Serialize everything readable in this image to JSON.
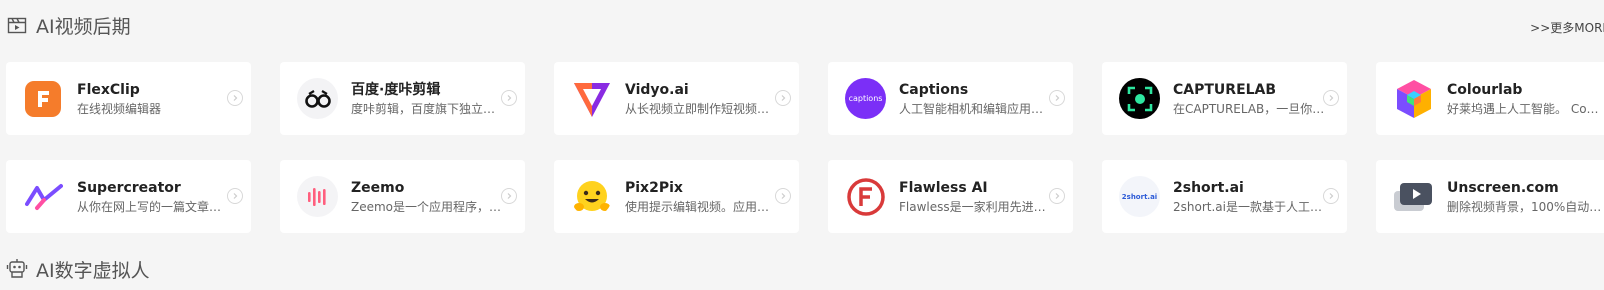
{
  "section1": {
    "title": "AI视频后期",
    "icon": "video-clapper-icon",
    "more_label": ">>更多MORE"
  },
  "section2": {
    "title": "AI数字虚拟人",
    "icon": "robot-icon"
  },
  "tools": [
    {
      "name": "FlexClip",
      "desc": "在线视频编辑器",
      "logo": "flexclip-logo"
    },
    {
      "name": "百度·度咔剪辑",
      "desc": "度咔剪辑，百度旗下独立…",
      "logo": "baidu-duka-logo"
    },
    {
      "name": "Vidyo.ai",
      "desc": "从长视频立即制作短视频…",
      "logo": "vidyo-logo"
    },
    {
      "name": "Captions",
      "desc": "人工智能相机和编辑应用…",
      "logo": "captions-logo",
      "logo_text": "captions"
    },
    {
      "name": "CAPTURELAB",
      "desc": "在CAPTURELAB，一旦你…",
      "logo": "capturelab-logo"
    },
    {
      "name": "Colourlab",
      "desc": "好莱坞遇上人工智能。 Co…",
      "logo": "colourlab-logo"
    },
    {
      "name": "Supercreator",
      "desc": "从你在网上写的一篇文章…",
      "logo": "supercreator-logo"
    },
    {
      "name": "Zeemo",
      "desc": "Zeemo是一个应用程序，…",
      "logo": "zeemo-logo"
    },
    {
      "name": "Pix2Pix",
      "desc": "使用提示编辑视频。应用…",
      "logo": "pix2pix-logo"
    },
    {
      "name": "Flawless AI",
      "desc": "Flawless是一家利用先进技…",
      "logo": "flawless-logo"
    },
    {
      "name": "2short.ai",
      "desc": "2short.ai是一款基于人工…",
      "logo": "2short-logo",
      "logo_text": "2short.ai"
    },
    {
      "name": "Unscreen.com",
      "desc": "删除视频背景，100%自动…",
      "logo": "unscreen-logo"
    }
  ],
  "colors": {
    "background": "#f5f5f5",
    "card": "#ffffff",
    "captions_purple": "#7b2ff7",
    "flexclip_orange": "#f57c2b",
    "flawless_red": "#d93a3a",
    "capturelab_green": "#2ee6a0"
  }
}
